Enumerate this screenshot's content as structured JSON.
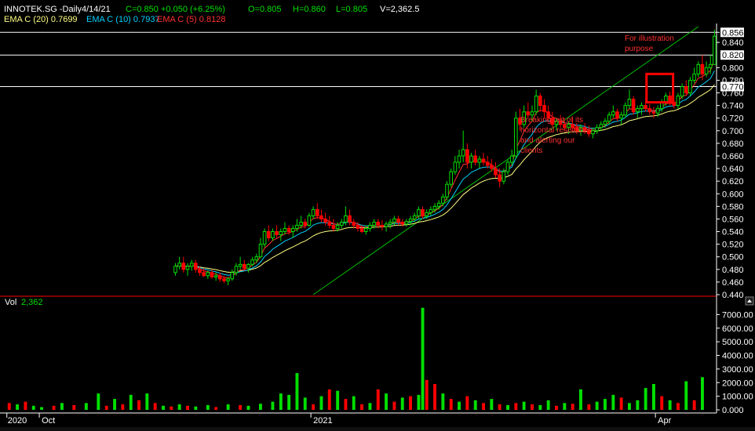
{
  "header": {
    "symbol": "INNOTEK.SG -Daily",
    "date": "4/14/21",
    "close": "C=0.850",
    "change": "+0.050 (+6.25%)",
    "open": "O=0.805",
    "high": "H=0.860",
    "low": "L=0.805",
    "volume": "V=2,362.5",
    "ema20": "EMA C (20) 0.7699",
    "ema10": "EMA C (10) 0.7937",
    "ema5": "EMA C (5) 0.8128"
  },
  "volume_panel": {
    "label": "Vol",
    "value": "2,362"
  },
  "annotations": {
    "illustration": [
      "For illustration",
      "purpose"
    ],
    "breakout": [
      "Breaking out of its",
      "horizontal resistance",
      "and alerting our",
      "clients"
    ]
  },
  "price_badges": [
    "0.856",
    "0.820",
    "0.770"
  ],
  "x_labels": [
    "2020",
    "Oct",
    "2021",
    "Apr"
  ],
  "colors": {
    "up": "#00e000",
    "down": "#ff0000",
    "ema5": "#ff3030",
    "ema10": "#00d0ff",
    "ema20": "#ffff80",
    "trend": "#00c000",
    "grid": "#ffffff",
    "text": "#ffffff",
    "badge_bg": "#ffffff",
    "badge_text": "#000000",
    "annotation": "#ff3030"
  },
  "chart_data": [
    {
      "type": "candlestick",
      "title": "INNOTEK.SG -Daily",
      "y_range": [
        0.44,
        0.87
      ],
      "y_ticks": [
        0.44,
        0.46,
        0.48,
        0.5,
        0.52,
        0.54,
        0.56,
        0.58,
        0.6,
        0.62,
        0.64,
        0.66,
        0.68,
        0.7,
        0.72,
        0.74,
        0.76,
        0.78,
        0.8,
        0.84,
        0.856
      ],
      "horizontal_lines": [
        0.856,
        0.82,
        0.77
      ],
      "trendline": {
        "start": [
          76,
          0.44
        ],
        "end": [
          171,
          0.865
        ]
      },
      "num_bars": 176,
      "x_label_positions": [
        {
          "label": "2020",
          "bar": 1
        },
        {
          "label": "Oct",
          "bar": 9
        },
        {
          "label": "2021",
          "bar": 76
        },
        {
          "label": "Apr",
          "bar": 161
        }
      ],
      "highlight_range": {
        "bars": [
          159,
          164
        ],
        "price": [
          0.745,
          0.79
        ]
      },
      "candles": [
        [
          0.475,
          0.49,
          0.47,
          0.485
        ],
        [
          0.485,
          0.5,
          0.48,
          0.49
        ],
        [
          0.49,
          0.5,
          0.475,
          0.48
        ],
        [
          0.48,
          0.49,
          0.47,
          0.485
        ],
        [
          0.485,
          0.495,
          0.478,
          0.49
        ],
        [
          0.49,
          0.495,
          0.475,
          0.48
        ],
        [
          0.48,
          0.485,
          0.47,
          0.475
        ],
        [
          0.475,
          0.482,
          0.468,
          0.47
        ],
        [
          0.47,
          0.478,
          0.465,
          0.475
        ],
        [
          0.475,
          0.48,
          0.465,
          0.468
        ],
        [
          0.468,
          0.475,
          0.462,
          0.47
        ],
        [
          0.47,
          0.475,
          0.46,
          0.465
        ],
        [
          0.465,
          0.47,
          0.458,
          0.462
        ],
        [
          0.462,
          0.468,
          0.455,
          0.465
        ],
        [
          0.465,
          0.48,
          0.462,
          0.475
        ],
        [
          0.475,
          0.49,
          0.47,
          0.485
        ],
        [
          0.485,
          0.5,
          0.48,
          0.488
        ],
        [
          0.488,
          0.495,
          0.478,
          0.482
        ],
        [
          0.482,
          0.49,
          0.475,
          0.488
        ],
        [
          0.488,
          0.5,
          0.485,
          0.495
        ],
        [
          0.495,
          0.505,
          0.49,
          0.5
        ],
        [
          0.5,
          0.53,
          0.498,
          0.52
        ],
        [
          0.52,
          0.545,
          0.515,
          0.54
        ],
        [
          0.54,
          0.55,
          0.525,
          0.53
        ],
        [
          0.53,
          0.545,
          0.525,
          0.54
        ],
        [
          0.54,
          0.55,
          0.53,
          0.535
        ],
        [
          0.535,
          0.545,
          0.525,
          0.54
        ],
        [
          0.54,
          0.555,
          0.535,
          0.545
        ],
        [
          0.545,
          0.55,
          0.535,
          0.54
        ],
        [
          0.54,
          0.55,
          0.53,
          0.545
        ],
        [
          0.545,
          0.56,
          0.54,
          0.55
        ],
        [
          0.55,
          0.565,
          0.545,
          0.555
        ],
        [
          0.555,
          0.56,
          0.545,
          0.55
        ],
        [
          0.55,
          0.57,
          0.548,
          0.565
        ],
        [
          0.565,
          0.58,
          0.56,
          0.575
        ],
        [
          0.575,
          0.585,
          0.56,
          0.565
        ],
        [
          0.565,
          0.575,
          0.555,
          0.56
        ],
        [
          0.56,
          0.57,
          0.55,
          0.555
        ],
        [
          0.555,
          0.565,
          0.545,
          0.55
        ],
        [
          0.55,
          0.56,
          0.54,
          0.545
        ],
        [
          0.545,
          0.555,
          0.54,
          0.55
        ],
        [
          0.55,
          0.56,
          0.545,
          0.555
        ],
        [
          0.555,
          0.58,
          0.55,
          0.565
        ],
        [
          0.565,
          0.575,
          0.55,
          0.555
        ],
        [
          0.555,
          0.56,
          0.545,
          0.55
        ],
        [
          0.55,
          0.555,
          0.54,
          0.545
        ],
        [
          0.545,
          0.55,
          0.538,
          0.54
        ],
        [
          0.54,
          0.55,
          0.535,
          0.545
        ],
        [
          0.545,
          0.555,
          0.54,
          0.55
        ],
        [
          0.55,
          0.56,
          0.545,
          0.555
        ],
        [
          0.555,
          0.56,
          0.545,
          0.55
        ],
        [
          0.55,
          0.558,
          0.542,
          0.548
        ],
        [
          0.548,
          0.556,
          0.54,
          0.552
        ],
        [
          0.552,
          0.56,
          0.545,
          0.555
        ],
        [
          0.555,
          0.565,
          0.55,
          0.56
        ],
        [
          0.56,
          0.565,
          0.55,
          0.555
        ],
        [
          0.555,
          0.56,
          0.548,
          0.552
        ],
        [
          0.552,
          0.56,
          0.548,
          0.556
        ],
        [
          0.556,
          0.565,
          0.55,
          0.56
        ],
        [
          0.56,
          0.57,
          0.555,
          0.565
        ],
        [
          0.565,
          0.58,
          0.56,
          0.575
        ],
        [
          0.575,
          0.58,
          0.56,
          0.565
        ],
        [
          0.565,
          0.575,
          0.56,
          0.57
        ],
        [
          0.57,
          0.58,
          0.565,
          0.575
        ],
        [
          0.575,
          0.585,
          0.57,
          0.58
        ],
        [
          0.58,
          0.59,
          0.575,
          0.585
        ],
        [
          0.585,
          0.6,
          0.58,
          0.595
        ],
        [
          0.595,
          0.62,
          0.59,
          0.615
        ],
        [
          0.615,
          0.64,
          0.61,
          0.635
        ],
        [
          0.635,
          0.66,
          0.63,
          0.65
        ],
        [
          0.65,
          0.67,
          0.64,
          0.66
        ],
        [
          0.66,
          0.7,
          0.65,
          0.67
        ],
        [
          0.67,
          0.68,
          0.64,
          0.65
        ],
        [
          0.65,
          0.665,
          0.64,
          0.66
        ],
        [
          0.66,
          0.67,
          0.645,
          0.65
        ],
        [
          0.65,
          0.66,
          0.64,
          0.655
        ],
        [
          0.655,
          0.665,
          0.645,
          0.65
        ],
        [
          0.65,
          0.66,
          0.64,
          0.645
        ],
        [
          0.645,
          0.655,
          0.635,
          0.64
        ],
        [
          0.64,
          0.65,
          0.625,
          0.63
        ],
        [
          0.63,
          0.64,
          0.61,
          0.62
        ],
        [
          0.62,
          0.64,
          0.615,
          0.635
        ],
        [
          0.635,
          0.655,
          0.63,
          0.65
        ],
        [
          0.65,
          0.67,
          0.645,
          0.66
        ],
        [
          0.66,
          0.73,
          0.655,
          0.72
        ],
        [
          0.72,
          0.735,
          0.7,
          0.71
        ],
        [
          0.71,
          0.74,
          0.705,
          0.73
        ],
        [
          0.73,
          0.745,
          0.72,
          0.725
        ],
        [
          0.725,
          0.74,
          0.715,
          0.73
        ],
        [
          0.73,
          0.765,
          0.725,
          0.755
        ],
        [
          0.755,
          0.76,
          0.73,
          0.74
        ],
        [
          0.74,
          0.75,
          0.72,
          0.73
        ],
        [
          0.73,
          0.74,
          0.715,
          0.72
        ],
        [
          0.72,
          0.73,
          0.705,
          0.71
        ],
        [
          0.71,
          0.72,
          0.7,
          0.715
        ],
        [
          0.715,
          0.725,
          0.705,
          0.71
        ],
        [
          0.71,
          0.72,
          0.7,
          0.705
        ],
        [
          0.705,
          0.715,
          0.695,
          0.71
        ],
        [
          0.71,
          0.72,
          0.7,
          0.705
        ],
        [
          0.705,
          0.712,
          0.695,
          0.7
        ],
        [
          0.7,
          0.71,
          0.692,
          0.705
        ],
        [
          0.705,
          0.712,
          0.695,
          0.7
        ],
        [
          0.7,
          0.708,
          0.69,
          0.695
        ],
        [
          0.695,
          0.705,
          0.688,
          0.7
        ],
        [
          0.7,
          0.71,
          0.695,
          0.705
        ],
        [
          0.705,
          0.715,
          0.7,
          0.71
        ],
        [
          0.71,
          0.72,
          0.705,
          0.715
        ],
        [
          0.715,
          0.73,
          0.71,
          0.725
        ],
        [
          0.725,
          0.74,
          0.72,
          0.73
        ],
        [
          0.73,
          0.735,
          0.715,
          0.72
        ],
        [
          0.72,
          0.73,
          0.71,
          0.725
        ],
        [
          0.725,
          0.745,
          0.72,
          0.74
        ],
        [
          0.74,
          0.765,
          0.735,
          0.75
        ],
        [
          0.75,
          0.755,
          0.725,
          0.73
        ],
        [
          0.73,
          0.74,
          0.72,
          0.735
        ],
        [
          0.735,
          0.745,
          0.725,
          0.74
        ],
        [
          0.74,
          0.75,
          0.73,
          0.735
        ],
        [
          0.735,
          0.742,
          0.725,
          0.73
        ],
        [
          0.73,
          0.738,
          0.72,
          0.728
        ],
        [
          0.728,
          0.74,
          0.722,
          0.735
        ],
        [
          0.735,
          0.75,
          0.73,
          0.745
        ],
        [
          0.745,
          0.76,
          0.74,
          0.755
        ],
        [
          0.755,
          0.762,
          0.74,
          0.745
        ],
        [
          0.745,
          0.75,
          0.735,
          0.74
        ],
        [
          0.74,
          0.76,
          0.735,
          0.755
        ],
        [
          0.755,
          0.775,
          0.75,
          0.77
        ],
        [
          0.77,
          0.78,
          0.755,
          0.76
        ],
        [
          0.76,
          0.785,
          0.755,
          0.78
        ],
        [
          0.78,
          0.8,
          0.775,
          0.79
        ],
        [
          0.79,
          0.81,
          0.785,
          0.805
        ],
        [
          0.805,
          0.82,
          0.78,
          0.79
        ],
        [
          0.79,
          0.81,
          0.785,
          0.8
        ],
        [
          0.8,
          0.82,
          0.79,
          0.805
        ],
        [
          0.805,
          0.86,
          0.805,
          0.85
        ]
      ]
    },
    {
      "type": "bar",
      "title": "Vol",
      "y_range": [
        0,
        8000
      ],
      "y_ticks": [
        0,
        1000,
        2000,
        3000,
        4000,
        5000,
        6000,
        7000
      ],
      "y_tick_labels": [
        "0.000",
        "1000.00",
        "2000.00",
        "3000.00",
        "4000.00",
        "5000.00",
        "6000.00",
        "7000.00"
      ],
      "values": [
        [
          1,
          500,
          "d"
        ],
        [
          3,
          400,
          "u"
        ],
        [
          5,
          600,
          "d"
        ],
        [
          7,
          300,
          "u"
        ],
        [
          9,
          200,
          "u"
        ],
        [
          12,
          300,
          "d"
        ],
        [
          14,
          500,
          "u"
        ],
        [
          17,
          350,
          "d"
        ],
        [
          20,
          500,
          "u"
        ],
        [
          23,
          1200,
          "u"
        ],
        [
          25,
          300,
          "d"
        ],
        [
          27,
          800,
          "u"
        ],
        [
          29,
          400,
          "d"
        ],
        [
          31,
          1100,
          "u"
        ],
        [
          33,
          700,
          "d"
        ],
        [
          35,
          1200,
          "u"
        ],
        [
          37,
          500,
          "d"
        ],
        [
          39,
          300,
          "u"
        ],
        [
          41,
          250,
          "d"
        ],
        [
          43,
          400,
          "u"
        ],
        [
          45,
          300,
          "d"
        ],
        [
          47,
          250,
          "u"
        ],
        [
          50,
          350,
          "u"
        ],
        [
          52,
          200,
          "d"
        ],
        [
          55,
          400,
          "u"
        ],
        [
          58,
          350,
          "d"
        ],
        [
          60,
          300,
          "u"
        ],
        [
          63,
          450,
          "u"
        ],
        [
          66,
          600,
          "u"
        ],
        [
          68,
          1200,
          "u"
        ],
        [
          70,
          1100,
          "u"
        ],
        [
          72,
          2700,
          "u"
        ],
        [
          74,
          900,
          "u"
        ],
        [
          76,
          400,
          "d"
        ],
        [
          78,
          1000,
          "u"
        ],
        [
          80,
          1500,
          "d"
        ],
        [
          82,
          1400,
          "u"
        ],
        [
          84,
          800,
          "d"
        ],
        [
          86,
          1000,
          "u"
        ],
        [
          88,
          400,
          "d"
        ],
        [
          90,
          500,
          "u"
        ],
        [
          92,
          1500,
          "d"
        ],
        [
          94,
          1200,
          "u"
        ],
        [
          96,
          600,
          "d"
        ],
        [
          98,
          900,
          "u"
        ],
        [
          100,
          1000,
          "d"
        ],
        [
          102,
          1100,
          "u"
        ],
        [
          103,
          7500,
          "u"
        ],
        [
          104,
          2200,
          "d"
        ],
        [
          106,
          1900,
          "d"
        ],
        [
          108,
          1200,
          "u"
        ],
        [
          110,
          800,
          "d"
        ],
        [
          112,
          600,
          "u"
        ],
        [
          114,
          1000,
          "d"
        ],
        [
          116,
          700,
          "u"
        ],
        [
          118,
          500,
          "d"
        ],
        [
          120,
          800,
          "u"
        ],
        [
          122,
          400,
          "d"
        ],
        [
          124,
          350,
          "u"
        ],
        [
          126,
          500,
          "d"
        ],
        [
          128,
          600,
          "u"
        ],
        [
          130,
          400,
          "d"
        ],
        [
          132,
          350,
          "u"
        ],
        [
          134,
          700,
          "u"
        ],
        [
          136,
          300,
          "d"
        ],
        [
          138,
          500,
          "u"
        ],
        [
          140,
          450,
          "d"
        ],
        [
          142,
          1500,
          "u"
        ],
        [
          144,
          400,
          "d"
        ],
        [
          146,
          600,
          "u"
        ],
        [
          148,
          800,
          "u"
        ],
        [
          150,
          1100,
          "u"
        ],
        [
          152,
          900,
          "d"
        ],
        [
          154,
          500,
          "u"
        ],
        [
          156,
          700,
          "u"
        ],
        [
          158,
          1600,
          "u"
        ],
        [
          160,
          1900,
          "u"
        ],
        [
          162,
          1000,
          "d"
        ],
        [
          164,
          700,
          "u"
        ],
        [
          166,
          500,
          "d"
        ],
        [
          168,
          2100,
          "u"
        ],
        [
          170,
          700,
          "d"
        ],
        [
          172,
          2400,
          "u"
        ]
      ]
    }
  ]
}
